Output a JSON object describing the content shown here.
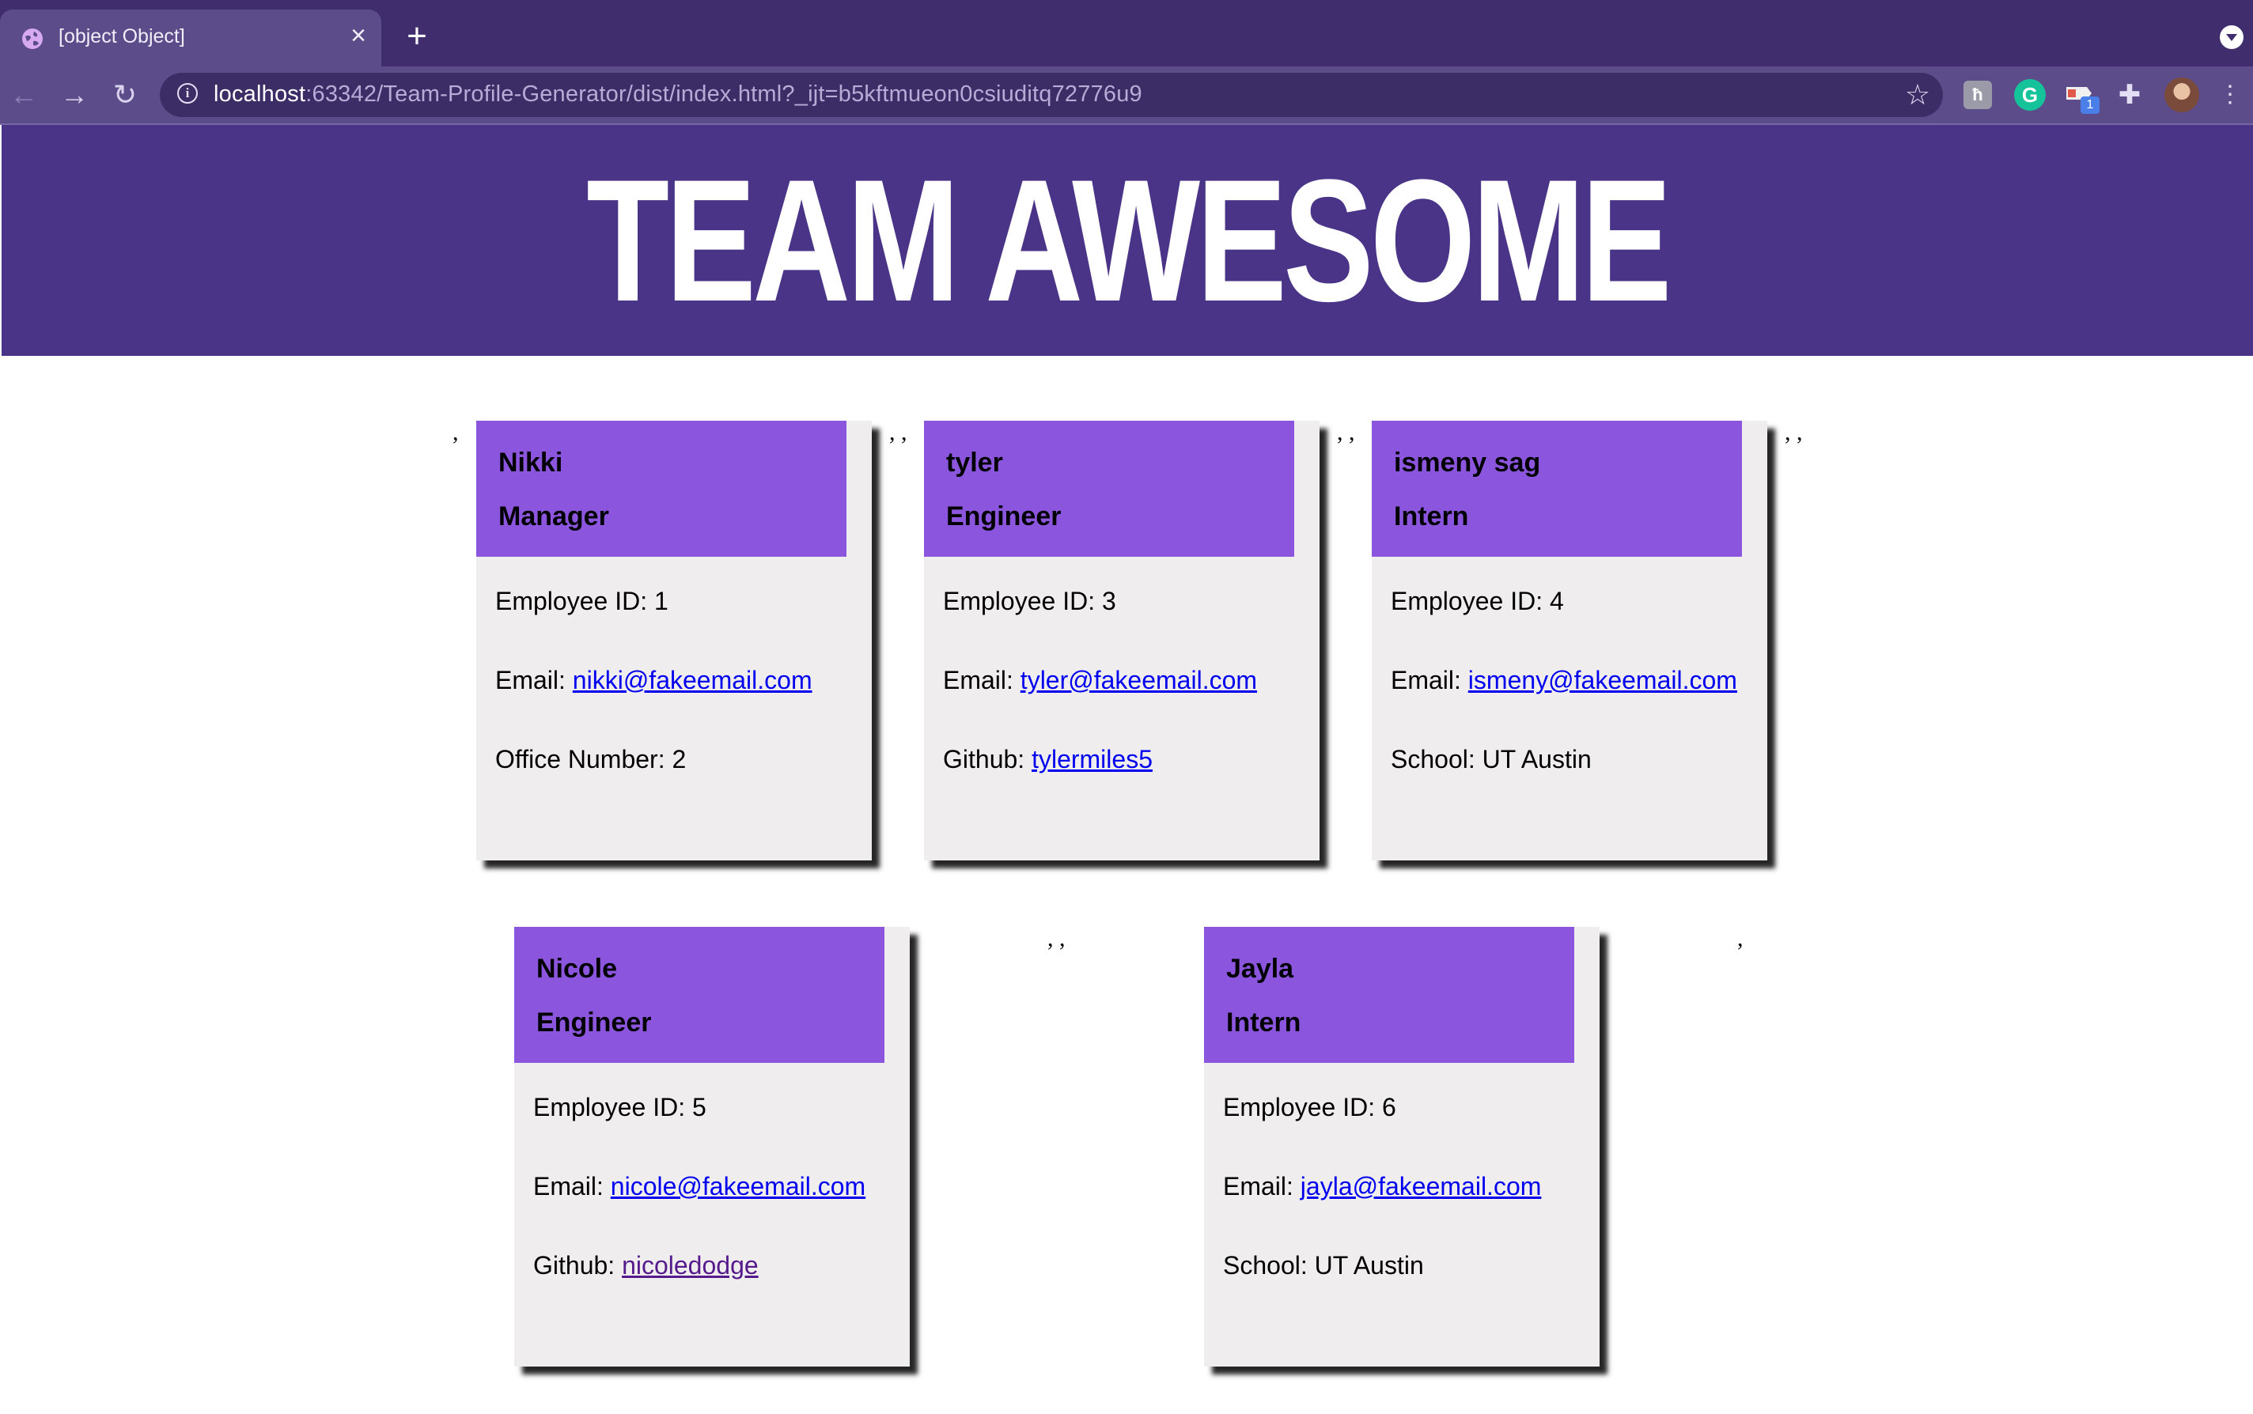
{
  "browser": {
    "tab_title": "[object Object]",
    "url_host": "localhost",
    "url_rest": ":63342/Team-Profile-Generator/dist/index.html?_ijt=b5kftmueon0csiuditq72776u9",
    "extension_badge": "1"
  },
  "page": {
    "title": "TEAM AWESOME",
    "stray_commas": [
      ",",
      ", ,",
      ", ,",
      ", ,",
      ", ,",
      ","
    ]
  },
  "team": [
    {
      "name": "Nikki",
      "role": "Manager",
      "id_line": "Employee ID: 1",
      "email_label": "Email: ",
      "email": "nikki@fakeemail.com",
      "extra_label": "Office Number: 2",
      "extra_link": ""
    },
    {
      "name": "tyler",
      "role": "Engineer",
      "id_line": "Employee ID: 3",
      "email_label": "Email: ",
      "email": "tyler@fakeemail.com",
      "extra_label": "Github: ",
      "extra_link": "tylermiles5"
    },
    {
      "name": "ismeny sag",
      "role": "Intern",
      "id_line": "Employee ID: 4",
      "email_label": "Email: ",
      "email": "ismeny@fakeemail.com",
      "extra_label": "School: UT Austin",
      "extra_link": ""
    },
    {
      "name": "Nicole",
      "role": "Engineer",
      "id_line": "Employee ID: 5",
      "email_label": "Email: ",
      "email": "nicole@fakeemail.com",
      "extra_label": "Github: ",
      "extra_link": "nicoledodge"
    },
    {
      "name": "Jayla",
      "role": "Intern",
      "id_line": "Employee ID: 6",
      "email_label": "Email: ",
      "email": "jayla@fakeemail.com",
      "extra_label": "School: UT Austin",
      "extra_link": ""
    }
  ],
  "colors": {
    "banner": "#4a3487",
    "card_header": "#8b56dd",
    "card_body": "#efedee",
    "link": "#0000ee",
    "visited_link": "#551a8b"
  }
}
